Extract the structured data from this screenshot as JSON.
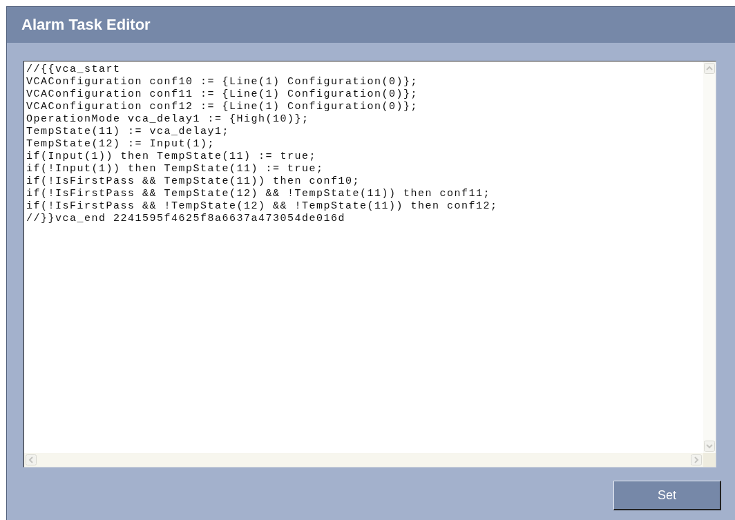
{
  "panel": {
    "title": "Alarm Task Editor"
  },
  "editor": {
    "lines": [
      "//{{vca_start",
      "VCAConfiguration conf10 := {Line(1) Configuration(0)};",
      "VCAConfiguration conf11 := {Line(1) Configuration(0)};",
      "VCAConfiguration conf12 := {Line(1) Configuration(0)};",
      "OperationMode vca_delay1 := {High(10)};",
      "TempState(11) := vca_delay1;",
      "TempState(12) := Input(1);",
      "if(Input(1)) then TempState(11) := true;",
      "if(!Input(1)) then TempState(11) := true;",
      "if(!IsFirstPass && TempState(11)) then conf10;",
      "if(!IsFirstPass && TempState(12) && !TempState(11)) then conf11;",
      "if(!IsFirstPass && !TempState(12) && !TempState(11)) then conf12;",
      "//}}vca_end 2241595f4625f8a6637a473054de016d"
    ]
  },
  "buttons": [
    "Set"
  ]
}
